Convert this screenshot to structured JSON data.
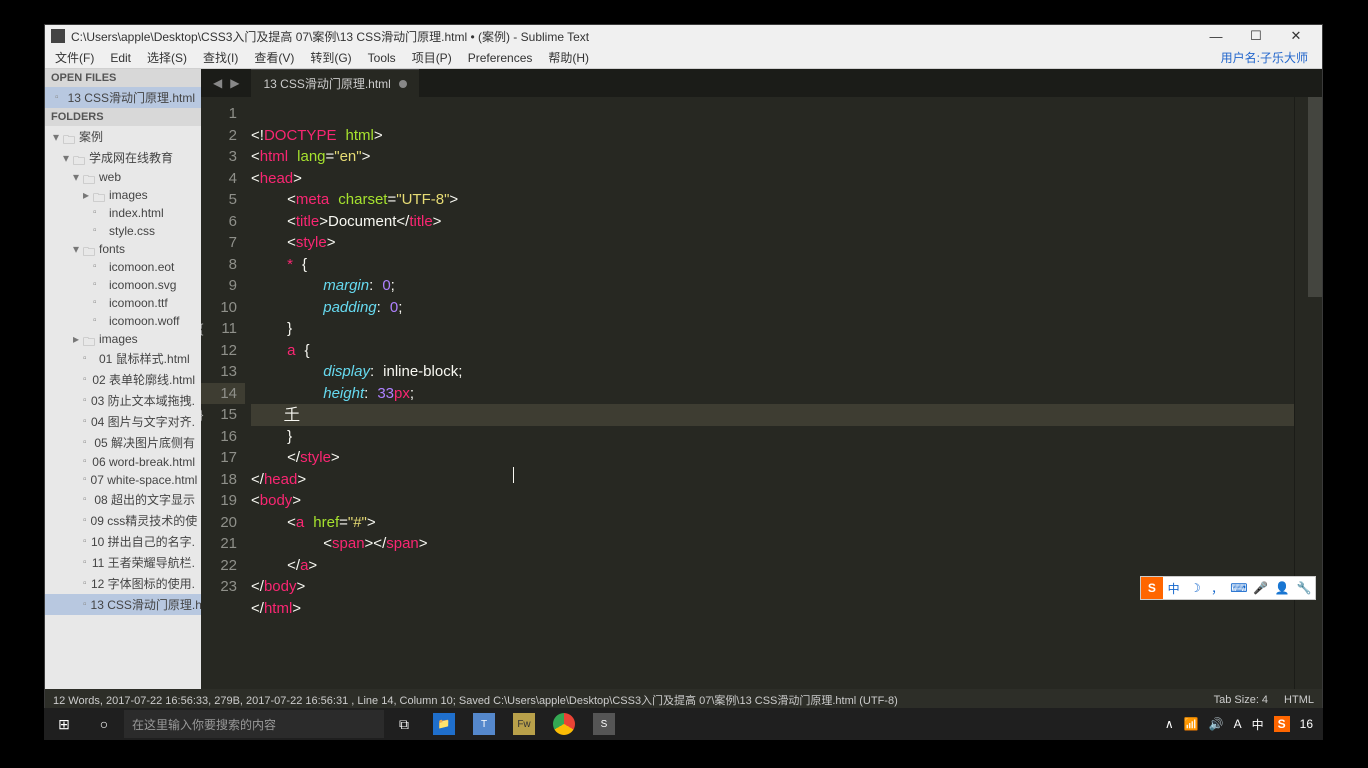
{
  "window": {
    "title": "C:\\Users\\apple\\Desktop\\CSS3入门及提高 07\\案例\\13 CSS滑动门原理.html • (案例) - Sublime Text",
    "buttons": {
      "min": "—",
      "max": "☐",
      "close": "✕"
    }
  },
  "menu": {
    "items": [
      "文件(F)",
      "Edit",
      "选择(S)",
      "查找(I)",
      "查看(V)",
      "转到(G)",
      "Tools",
      "项目(P)",
      "Preferences",
      "帮助(H)"
    ],
    "user_label": "用户名:子乐大师"
  },
  "sidebar": {
    "open_files_header": "OPEN FILES",
    "open_file": "13 CSS滑动门原理.html",
    "folders_header": "FOLDERS",
    "tree": {
      "root": "案例",
      "node1": "学成网在线教育",
      "node2": "web",
      "node3": "images",
      "file_index": "index.html",
      "file_style": "style.css",
      "node_fonts": "fonts",
      "font_files": [
        "icomoon.eot",
        "icomoon.svg",
        "icomoon.ttf",
        "icomoon.woff"
      ],
      "node_images2": "images",
      "html_files": [
        "01 鼠标样式.html",
        "02 表单轮廓线.html",
        "03 防止文本域拖拽.",
        "04 图片与文字对齐.",
        "05 解决图片底侧有",
        "06 word-break.html",
        "07 white-space.html",
        "08 超出的文字显示",
        "09 css精灵技术的使",
        "10 拼出自己的名字.",
        "11 王者荣耀导航栏.",
        "12 字体图标的使用.",
        "13 CSS滑动门原理.h"
      ]
    }
  },
  "tabs": {
    "nav_back": "◀",
    "nav_fwd": "▶",
    "tab1_label": "13 CSS滑动门原理.html"
  },
  "code": {
    "lines": [
      "<!DOCTYPE html>",
      "<html lang=\"en\">",
      "<head>",
      "    <meta charset=\"UTF-8\">",
      "    <title>Document</title>",
      "    <style>",
      "    * {",
      "        margin: 0;",
      "        padding: 0;",
      "    }",
      "    a {",
      "        display: inline-block;",
      "        height: 33px;",
      "        千",
      "    }",
      "    </style>",
      "</head>",
      "<body>",
      "    <a href=\"#\">",
      "        <span></span>",
      "    </a>",
      "</body>",
      "</html>"
    ],
    "cursor_mark_line14": "千"
  },
  "status": {
    "left": "12 Words, 2017-07-22 16:56:33, 279B, 2017-07-22 16:56:31 , Line 14, Column 10; Saved C:\\Users\\apple\\Desktop\\CSS3入门及提高 07\\案例\\13 CSS滑动门原理.html (UTF-8)",
    "tab_size": "Tab Size: 4",
    "syntax": "HTML"
  },
  "ime": {
    "s": "S",
    "zhong": "中",
    "moon": "☽",
    "comma": "，",
    "kbd": "⌨",
    "mic": "🎤",
    "person": "👤",
    "wrench": "🔧"
  },
  "taskbar": {
    "start": "⊞",
    "cortana": "○",
    "search_placeholder": "在这里输入你要搜索的内容",
    "taskview": "⧉",
    "apps": [
      {
        "label": "📁",
        "bg": "#1f6fcc"
      },
      {
        "label": "T",
        "bg": "#5588cc"
      },
      {
        "label": "Fw",
        "bg": "#b8a04a"
      },
      {
        "label": "",
        "bg": "linear-gradient(#4285f4 0 25%,#ea4335 0 50%,#fbbc05 0 75%,#34a853 0)"
      },
      {
        "label": "S",
        "bg": "#555"
      }
    ],
    "tray": {
      "up": "∧",
      "net": "📶",
      "vol": "🔊",
      "ime1": "A",
      "ime2": "中",
      "sogou": "S",
      "time": "16"
    }
  }
}
